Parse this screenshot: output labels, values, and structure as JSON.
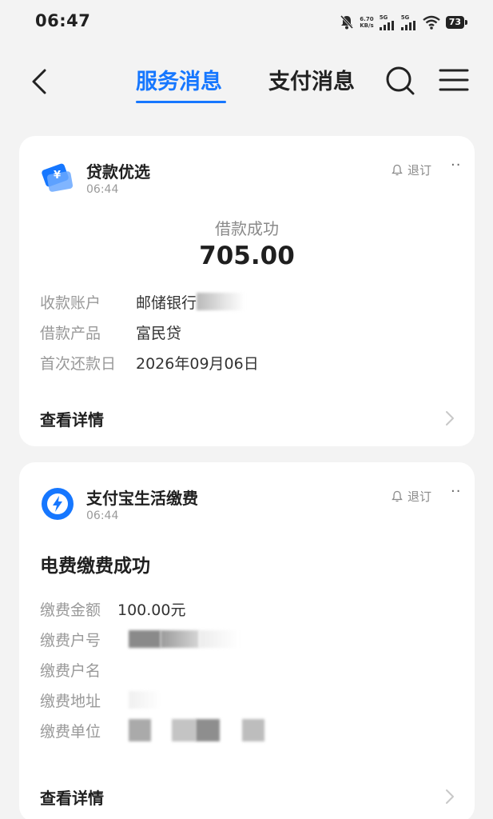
{
  "status_bar": {
    "time": "06:47",
    "net_speed_value": "6.70",
    "net_speed_unit": "KB/s",
    "signal_label_1": "5G",
    "signal_label_2": "5G",
    "battery": "73"
  },
  "nav": {
    "tabs": [
      {
        "label": "服务消息",
        "active": true
      },
      {
        "label": "支付消息",
        "active": false
      }
    ],
    "accent_color": "#1677ff"
  },
  "cards": [
    {
      "app_name": "贷款优选",
      "time": "06:44",
      "subscribe_label": "退订",
      "more_label": "··",
      "icon": "loan-card-icon",
      "caption": "借款成功",
      "amount": "705.00",
      "rows": [
        {
          "key": "收款账户",
          "value": "邮储银行"
        },
        {
          "key": "借款产品",
          "value": "富民贷"
        },
        {
          "key": "首次还款日",
          "value": "2026年09月06日"
        }
      ],
      "detail_label": "查看详情"
    },
    {
      "app_name": "支付宝生活缴费",
      "time": "06:44",
      "subscribe_label": "退订",
      "more_label": "··",
      "icon": "lightning-icon",
      "title": "电费缴费成功",
      "rows": [
        {
          "key": "缴费金额",
          "value": "100.00元"
        },
        {
          "key": "缴费户号",
          "value": ""
        },
        {
          "key": "缴费户名",
          "value": ""
        },
        {
          "key": "缴费地址",
          "value": ""
        },
        {
          "key": "缴费单位",
          "value": ""
        }
      ],
      "detail_label": "查看详情"
    }
  ]
}
